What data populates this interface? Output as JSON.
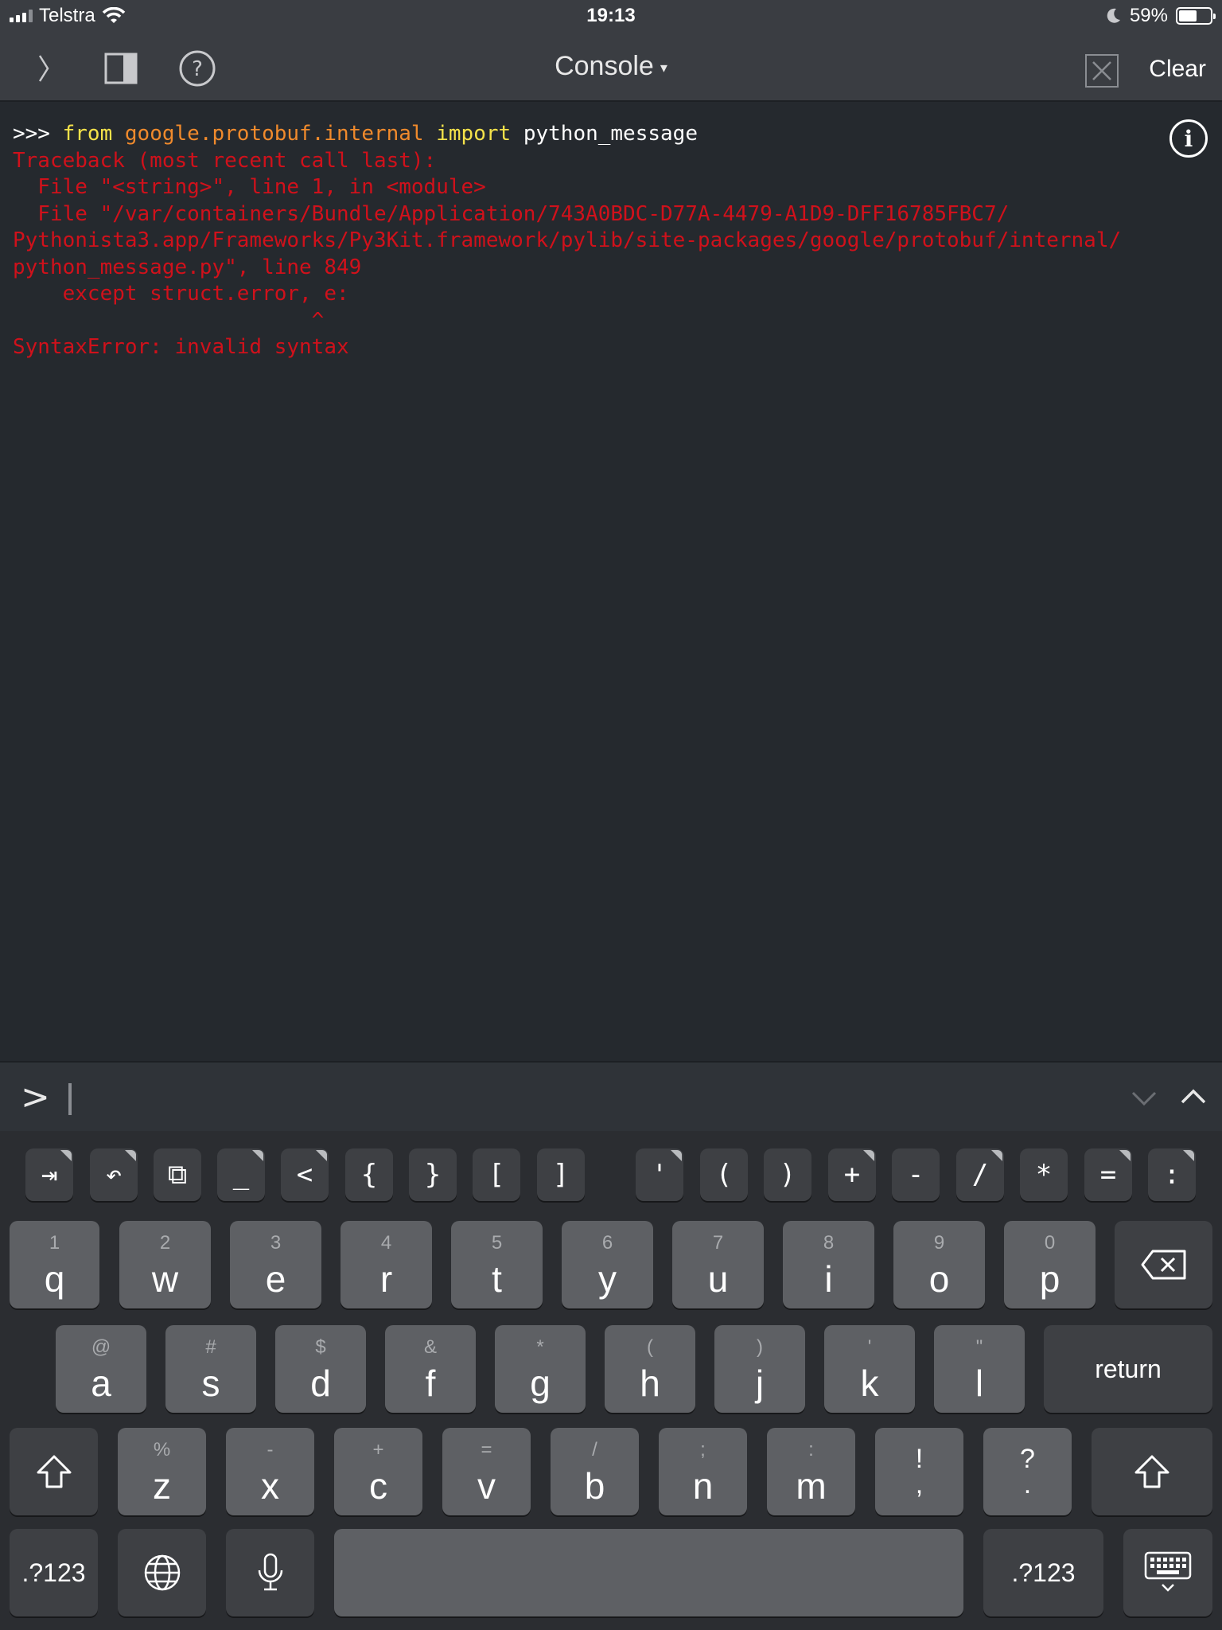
{
  "status_bar": {
    "carrier": "Telstra",
    "time": "19:13",
    "battery": "59%",
    "battery_level": 0.59
  },
  "toolbar": {
    "title": "Console",
    "title_caret": "▾",
    "clear_label": "Clear"
  },
  "console": {
    "command": {
      "prompt": ">>> ",
      "kw_from": "from",
      "module": "google.protobuf.internal",
      "kw_import": "import",
      "name": "python_message"
    },
    "error_lines": [
      "Traceback (most recent call last):",
      "  File \"<string>\", line 1, in <module>",
      "  File \"/var/containers/Bundle/Application/743A0BDC-D77A-4479-A1D9-DFF16785FBC7/",
      "Pythonista3.app/Frameworks/Py3Kit.framework/pylib/site-packages/google/protobuf/internal/",
      "python_message.py\", line 849",
      "    except struct.error, e:",
      "                        ^",
      "SyntaxError: invalid syntax"
    ]
  },
  "input": {
    "prompt": ">"
  },
  "keyboard": {
    "symbol_row": [
      "⇥",
      "↶",
      "⧉",
      "_",
      "<",
      "{",
      "}",
      "[",
      "]",
      "'",
      "(",
      ")",
      "+",
      "-",
      "/",
      "*",
      "=",
      ":"
    ],
    "row1": [
      {
        "main": "q",
        "alt": "1"
      },
      {
        "main": "w",
        "alt": "2"
      },
      {
        "main": "e",
        "alt": "3"
      },
      {
        "main": "r",
        "alt": "4"
      },
      {
        "main": "t",
        "alt": "5"
      },
      {
        "main": "y",
        "alt": "6"
      },
      {
        "main": "u",
        "alt": "7"
      },
      {
        "main": "i",
        "alt": "8"
      },
      {
        "main": "o",
        "alt": "9"
      },
      {
        "main": "p",
        "alt": "0"
      }
    ],
    "row2": [
      {
        "main": "a",
        "alt": "@"
      },
      {
        "main": "s",
        "alt": "#"
      },
      {
        "main": "d",
        "alt": "$"
      },
      {
        "main": "f",
        "alt": "&"
      },
      {
        "main": "g",
        "alt": "*"
      },
      {
        "main": "h",
        "alt": "("
      },
      {
        "main": "j",
        "alt": ")"
      },
      {
        "main": "k",
        "alt": "'"
      },
      {
        "main": "l",
        "alt": "\""
      }
    ],
    "row3": [
      {
        "main": "z",
        "alt": "%"
      },
      {
        "main": "x",
        "alt": "-"
      },
      {
        "main": "c",
        "alt": "+"
      },
      {
        "main": "v",
        "alt": "="
      },
      {
        "main": "b",
        "alt": "/"
      },
      {
        "main": "n",
        "alt": ";"
      },
      {
        "main": "m",
        "alt": ":"
      }
    ],
    "row3_punct": [
      {
        "top": "!",
        "bottom": ","
      },
      {
        "top": "?",
        "bottom": "."
      }
    ],
    "return_label": "return",
    "numbers_label": ".?123",
    "icons": {
      "tab": "tab-icon",
      "undo": "undo-icon",
      "paste": "paste-icon",
      "delete": "delete-icon",
      "shift": "shift-icon",
      "globe": "globe-icon",
      "mic": "microphone-icon",
      "hide": "keyboard-dismiss-icon"
    }
  }
}
